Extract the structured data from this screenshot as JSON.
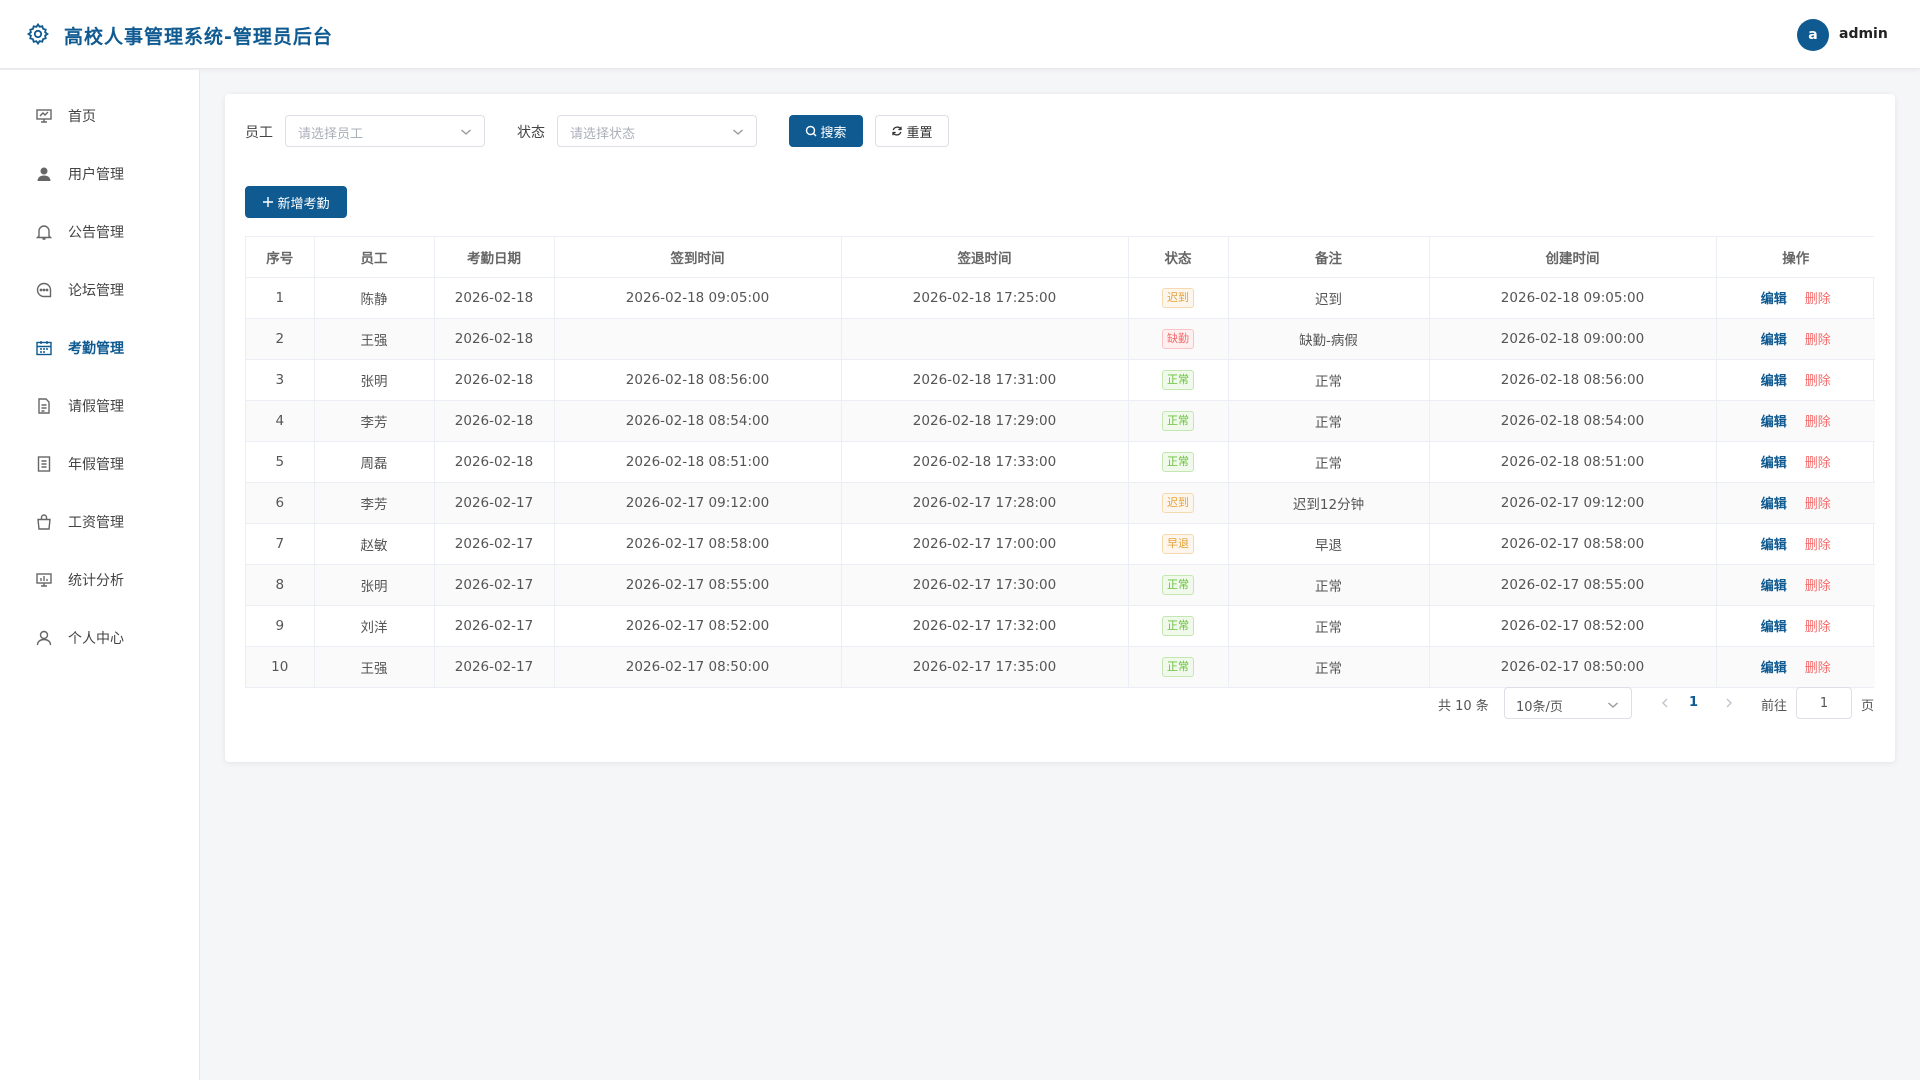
{
  "header": {
    "title": "高校人事管理系统-管理员后台",
    "avatar_letter": "a",
    "username": "admin"
  },
  "colors": {
    "primary": "#0f5a91",
    "danger": "#f56c6c",
    "success": "#67c23a",
    "warning": "#e6a23c"
  },
  "sidebar": {
    "items": [
      {
        "label": "首页",
        "icon": "dashboard-icon",
        "active": false
      },
      {
        "label": "用户管理",
        "icon": "user-icon",
        "active": false
      },
      {
        "label": "公告管理",
        "icon": "bell-icon",
        "active": false
      },
      {
        "label": "论坛管理",
        "icon": "chat-icon",
        "active": false
      },
      {
        "label": "考勤管理",
        "icon": "calendar-icon",
        "active": true
      },
      {
        "label": "请假管理",
        "icon": "document-icon",
        "active": false
      },
      {
        "label": "年假管理",
        "icon": "notebook-icon",
        "active": false
      },
      {
        "label": "工资管理",
        "icon": "bag-icon",
        "active": false
      },
      {
        "label": "统计分析",
        "icon": "chart-icon",
        "active": false
      },
      {
        "label": "个人中心",
        "icon": "person-icon",
        "active": false
      }
    ]
  },
  "filters": {
    "employee_label": "员工",
    "employee_placeholder": "请选择员工",
    "status_label": "状态",
    "status_placeholder": "请选择状态",
    "search_label": "搜索",
    "reset_label": "重置"
  },
  "add_button_label": "新增考勤",
  "table": {
    "columns": [
      "序号",
      "员工",
      "考勤日期",
      "签到时间",
      "签退时间",
      "状态",
      "备注",
      "创建时间",
      "操作"
    ],
    "rows": [
      {
        "no": "1",
        "employee": "陈静",
        "date": "2026-02-18",
        "check_in": "2026-02-18 09:05:00",
        "check_out": "2026-02-18 17:25:00",
        "status": "迟到",
        "status_type": "late",
        "remark": "迟到",
        "created": "2026-02-18 09:05:00"
      },
      {
        "no": "2",
        "employee": "王强",
        "date": "2026-02-18",
        "check_in": "",
        "check_out": "",
        "status": "缺勤",
        "status_type": "absent",
        "remark": "缺勤-病假",
        "created": "2026-02-18 09:00:00"
      },
      {
        "no": "3",
        "employee": "张明",
        "date": "2026-02-18",
        "check_in": "2026-02-18 08:56:00",
        "check_out": "2026-02-18 17:31:00",
        "status": "正常",
        "status_type": "normal",
        "remark": "正常",
        "created": "2026-02-18 08:56:00"
      },
      {
        "no": "4",
        "employee": "李芳",
        "date": "2026-02-18",
        "check_in": "2026-02-18 08:54:00",
        "check_out": "2026-02-18 17:29:00",
        "status": "正常",
        "status_type": "normal",
        "remark": "正常",
        "created": "2026-02-18 08:54:00"
      },
      {
        "no": "5",
        "employee": "周磊",
        "date": "2026-02-18",
        "check_in": "2026-02-18 08:51:00",
        "check_out": "2026-02-18 17:33:00",
        "status": "正常",
        "status_type": "normal",
        "remark": "正常",
        "created": "2026-02-18 08:51:00"
      },
      {
        "no": "6",
        "employee": "李芳",
        "date": "2026-02-17",
        "check_in": "2026-02-17 09:12:00",
        "check_out": "2026-02-17 17:28:00",
        "status": "迟到",
        "status_type": "late",
        "remark": "迟到12分钟",
        "created": "2026-02-17 09:12:00"
      },
      {
        "no": "7",
        "employee": "赵敏",
        "date": "2026-02-17",
        "check_in": "2026-02-17 08:58:00",
        "check_out": "2026-02-17 17:00:00",
        "status": "早退",
        "status_type": "early",
        "remark": "早退",
        "created": "2026-02-17 08:58:00"
      },
      {
        "no": "8",
        "employee": "张明",
        "date": "2026-02-17",
        "check_in": "2026-02-17 08:55:00",
        "check_out": "2026-02-17 17:30:00",
        "status": "正常",
        "status_type": "normal",
        "remark": "正常",
        "created": "2026-02-17 08:55:00"
      },
      {
        "no": "9",
        "employee": "刘洋",
        "date": "2026-02-17",
        "check_in": "2026-02-17 08:52:00",
        "check_out": "2026-02-17 17:32:00",
        "status": "正常",
        "status_type": "normal",
        "remark": "正常",
        "created": "2026-02-17 08:52:00"
      },
      {
        "no": "10",
        "employee": "王强",
        "date": "2026-02-17",
        "check_in": "2026-02-17 08:50:00",
        "check_out": "2026-02-17 17:35:00",
        "status": "正常",
        "status_type": "normal",
        "remark": "正常",
        "created": "2026-02-17 08:50:00"
      }
    ],
    "edit_label": "编辑",
    "delete_label": "删除"
  },
  "pagination": {
    "total_text": "共 10 条",
    "page_size": "10条/页",
    "current_page": "1",
    "goto_label": "前往",
    "goto_value": "1",
    "page_suffix": "页"
  }
}
